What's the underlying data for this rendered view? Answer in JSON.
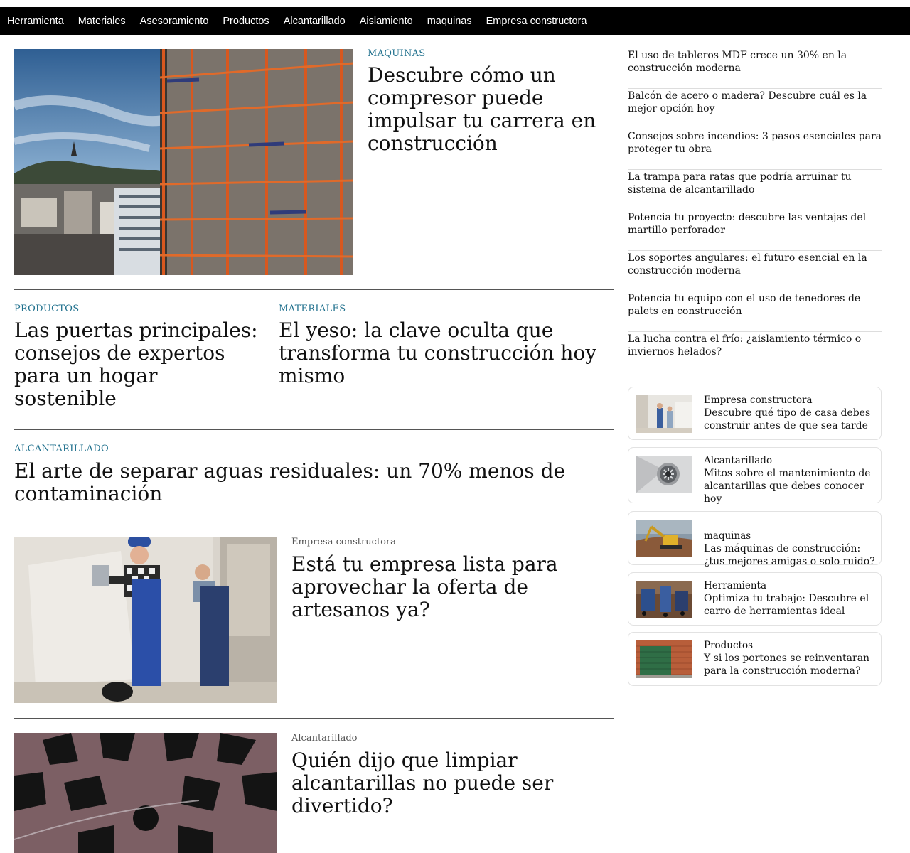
{
  "nav": {
    "items": [
      "Herramienta",
      "Materiales",
      "Asesoramiento",
      "Productos",
      "Alcantarillado",
      "Aislamiento",
      "maquinas",
      "Empresa constructora"
    ]
  },
  "featured": {
    "category": "MAQUINAS",
    "title": "Descubre cómo un compresor puede impulsar tu carrera en construcción",
    "image": "scaffolding-building-photo"
  },
  "row2": [
    {
      "category": "PRODUCTOS",
      "title": "Las puertas principales: consejos de expertos para un hogar sostenible"
    },
    {
      "category": "MATERIALES",
      "title": "El yeso: la clave oculta que transforma tu construcción hoy mismo"
    }
  ],
  "wide": {
    "category": "ALCANTARILLADO",
    "title": "El arte de separar aguas residuales: un 70% menos de contaminación"
  },
  "articles": [
    {
      "category": "Empresa constructora",
      "title": "Está tu empresa lista para aprovechar la oferta de artesanos ya?",
      "image": "plasterers-working-photo"
    },
    {
      "category": "Alcantarillado",
      "title": "Quién dijo que limpiar alcantarillas no puede ser divertido?",
      "image": "drain-grate-photo"
    }
  ],
  "sidebar": {
    "links": [
      "El uso de tableros MDF crece un 30% en la construcción moderna",
      "Balcón de acero o madera? Descubre cuál es la mejor opción hoy",
      "Consejos sobre incendios: 3 pasos esenciales para proteger tu obra",
      "La trampa para ratas que podría arruinar tu sistema de alcantarillado",
      "Potencia tu proyecto: descubre las ventajas del martillo perforador",
      "Los soportes angulares: el futuro esencial en la construcción moderna",
      "Potencia tu equipo con el uso de tenedores de palets en construcción",
      "La lucha contra el frío: ¿aislamiento térmico o inviernos helados?"
    ],
    "cards": [
      {
        "category": "Empresa constructora",
        "title": "Descubre qué tipo de casa debes construir antes de que sea tarde",
        "image": "interior-workers-thumb"
      },
      {
        "category": "Alcantarillado",
        "title": "Mitos sobre el mantenimiento de alcantarillas que debes conocer hoy",
        "image": "drain-thumb"
      },
      {
        "category": "maquinas",
        "title": "Las máquinas de construcción: ¿tus mejores amigas o solo ruido?",
        "image": "excavator-thumb"
      },
      {
        "category": "Herramienta",
        "title": "Optimiza tu trabajo: Descubre el carro de herramientas ideal",
        "image": "tool-cart-thumb"
      },
      {
        "category": "Productos",
        "title": "Y si los portones se reinventaran para la construcción moderna?",
        "image": "garage-door-thumb"
      }
    ]
  }
}
